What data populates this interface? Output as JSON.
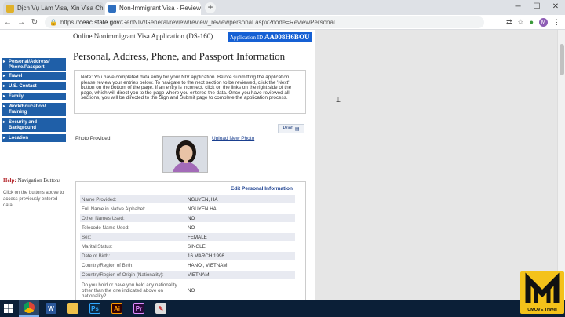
{
  "browser": {
    "tabs": [
      {
        "label": "Dịch Vụ Làm Visa, Xin Visa Chuy...",
        "favicon_color": "#e0b12a"
      },
      {
        "label": "Non-Immigrant Visa - Review Pe",
        "favicon_color": "#2f6fbf"
      }
    ],
    "new_tab": "+",
    "url_host": "ceac.state.gov",
    "url_path": "/GenNIV/General/review/review_reviewpersonal.aspx?node=ReviewPersonal",
    "url_prefix": "https://",
    "avatar_letter": "M"
  },
  "header": {
    "title": "Online Nonimmigrant Visa Application (DS-160)",
    "app_id_label": "Application ID",
    "app_id_value": "AA008H6BOU"
  },
  "sidebar": {
    "items": [
      {
        "label": "Personal/Address/ Phone/Passport"
      },
      {
        "label": "Travel"
      },
      {
        "label": "U.S. Contact"
      },
      {
        "label": "Family"
      },
      {
        "label": "Work/Education/ Training"
      },
      {
        "label": "Security and Background"
      },
      {
        "label": "Location"
      }
    ],
    "help_prefix": "Help:",
    "help_title": "Navigation Buttons",
    "help_text": "Click on the buttons above to access previously entered data"
  },
  "main": {
    "page_title": "Personal, Address, Phone, and Passport Information",
    "note": "Note: You have completed data entry for your NIV application. Before submitting the application, please review your entries below. To navigate to the next section to be reviewed, click the 'Next' button on the bottom of the page. If an entry is incorrect, click on the links on the right side of the page, which will direct you to the page where you entered the data. Once you have reviewed all sections, you will be directed to the Sign and Submit page to complete the application process.",
    "print_label": "Print",
    "photo_label": "Photo Provided:",
    "upload_label": "Upload New Photo",
    "edit_label": "Edit Personal Information",
    "rows": [
      {
        "key": "Name Provided:",
        "value": "NGUYEN, HA"
      },
      {
        "key": "Full Name in Native Alphabet:",
        "value": "NGUYEN HA"
      },
      {
        "key": "Other Names Used:",
        "value": "NO"
      },
      {
        "key": "Telecode Name Used:",
        "value": "NO"
      },
      {
        "key": "Sex:",
        "value": "FEMALE"
      },
      {
        "key": "Marital Status:",
        "value": "SINGLE"
      },
      {
        "key": "Date of Birth:",
        "value": "16 MARCH 1996"
      },
      {
        "key": "Country/Region of Birth:",
        "value": "HANOI, VIETNAM"
      },
      {
        "key": "Country/Region of Origin (Nationality):",
        "value": "VIETNAM"
      },
      {
        "key": "Do you hold or have you held any nationality other than the one indicated above on nationality?",
        "value": "NO"
      }
    ]
  },
  "logo": {
    "text": "UMOVE Travel",
    "mark": "M"
  },
  "colors": {
    "sidebar": "#1f5fa8",
    "app_id_bg": "#1560d4",
    "taskbar": "#0b1f37",
    "logo": "#f4c21a"
  }
}
